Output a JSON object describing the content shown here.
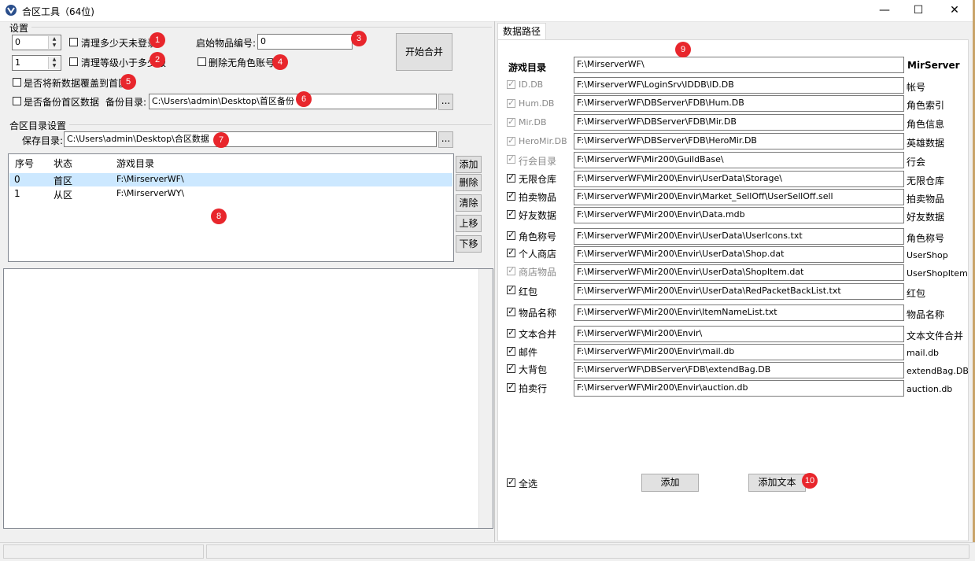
{
  "window": {
    "title": "合区工具（64位)",
    "minimize": "—",
    "maximize": "☐",
    "close": "✕"
  },
  "settings": {
    "group_label": "设置",
    "spin1_value": "0",
    "spin2_value": "1",
    "clean_days_label": "清理多少天未登录",
    "clean_level_label": "清理等级小于多少级",
    "start_item_label": "启始物品编号:",
    "start_item_value": "0",
    "delete_no_role_label": "删除无角色账号",
    "overwrite_main_label": "是否将新数据覆盖到首区",
    "backup_main_label": "是否备份首区数据",
    "backup_dir_label": "备份目录:",
    "backup_dir_value": "C:\\Users\\admin\\Desktop\\首区备份",
    "browse_label": "...",
    "start_merge_label": "开始合并"
  },
  "merge_dir": {
    "group_label": "合区目录设置",
    "save_dir_label": "保存目录:",
    "save_dir_value": "C:\\Users\\admin\\Desktop\\合区数据",
    "browse_label": "..."
  },
  "server_list": {
    "columns": [
      "序号",
      "状态",
      "游戏目录"
    ],
    "rows": [
      {
        "index": "0",
        "status": "首区",
        "dir": "F:\\MirserverWF\\"
      },
      {
        "index": "1",
        "status": "从区",
        "dir": "F:\\MirserverWY\\"
      }
    ],
    "buttons": {
      "add": "添加",
      "delete": "删除",
      "clear": "清除",
      "up": "上移",
      "down": "下移"
    }
  },
  "data_paths": {
    "tab_label": "数据路径",
    "game_dir_label": "游戏目录",
    "game_dir_value": "F:\\MirserverWF\\",
    "game_dir_right": "MirServer",
    "rows": [
      {
        "label": "ID.DB",
        "path": "F:\\MirserverWF\\LoginSrv\\IDDB\\ID.DB",
        "right": "帐号"
      },
      {
        "label": "Hum.DB",
        "path": "F:\\MirserverWF\\DBServer\\FDB\\Hum.DB",
        "right": "角色索引"
      },
      {
        "label": "Mir.DB",
        "path": "F:\\MirserverWF\\DBServer\\FDB\\Mir.DB",
        "right": "角色信息"
      },
      {
        "label": "HeroMir.DB",
        "path": "F:\\MirserverWF\\DBServer\\FDB\\HeroMir.DB",
        "right": "英雄数据"
      },
      {
        "label": "行会目录",
        "path": "F:\\MirserverWF\\Mir200\\GuildBase\\",
        "right": "行会"
      },
      {
        "label": "无限仓库",
        "path": "F:\\MirserverWF\\Mir200\\Envir\\UserData\\Storage\\",
        "right": "无限仓库"
      },
      {
        "label": "拍卖物品",
        "path": "F:\\MirserverWF\\Mir200\\Envir\\Market_SellOff\\UserSellOff.sell",
        "right": "拍卖物品"
      },
      {
        "label": "好友数据",
        "path": "F:\\MirserverWF\\Mir200\\Envir\\Data.mdb",
        "right": "好友数据"
      },
      {
        "label": "角色称号",
        "path": "F:\\MirserverWF\\Mir200\\Envir\\UserData\\UserIcons.txt",
        "right": "角色称号"
      },
      {
        "label": "个人商店",
        "path": "F:\\MirserverWF\\Mir200\\Envir\\UserData\\Shop.dat",
        "right": "UserShop"
      },
      {
        "label": "商店物品",
        "path": "F:\\MirserverWF\\Mir200\\Envir\\UserData\\ShopItem.dat",
        "right": "UserShopItem"
      },
      {
        "label": "红包",
        "path": "F:\\MirserverWF\\Mir200\\Envir\\UserData\\RedPacketBackList.txt",
        "right": "红包"
      },
      {
        "label": "物品名称",
        "path": "F:\\MirserverWF\\Mir200\\Envir\\ItemNameList.txt",
        "right": "物品名称"
      },
      {
        "label": "文本合并",
        "path": "F:\\MirserverWF\\Mir200\\Envir\\",
        "right": "文本文件合并"
      },
      {
        "label": "邮件",
        "path": "F:\\MirserverWF\\Mir200\\Envir\\mail.db",
        "right": "mail.db"
      },
      {
        "label": "大背包",
        "path": "F:\\MirserverWF\\DBServer\\FDB\\extendBag.DB",
        "right": "extendBag.DB"
      },
      {
        "label": "拍卖行",
        "path": "F:\\MirserverWF\\Mir200\\Envir\\auction.db",
        "right": "auction.db"
      }
    ],
    "select_all_label": "全选",
    "add_label": "添加",
    "add_text_label": "添加文本"
  },
  "badges": [
    "1",
    "2",
    "3",
    "4",
    "5",
    "6",
    "7",
    "8",
    "9",
    "10"
  ],
  "colors": {
    "badge": "#e8262c",
    "selected_row": "#cce8ff"
  }
}
